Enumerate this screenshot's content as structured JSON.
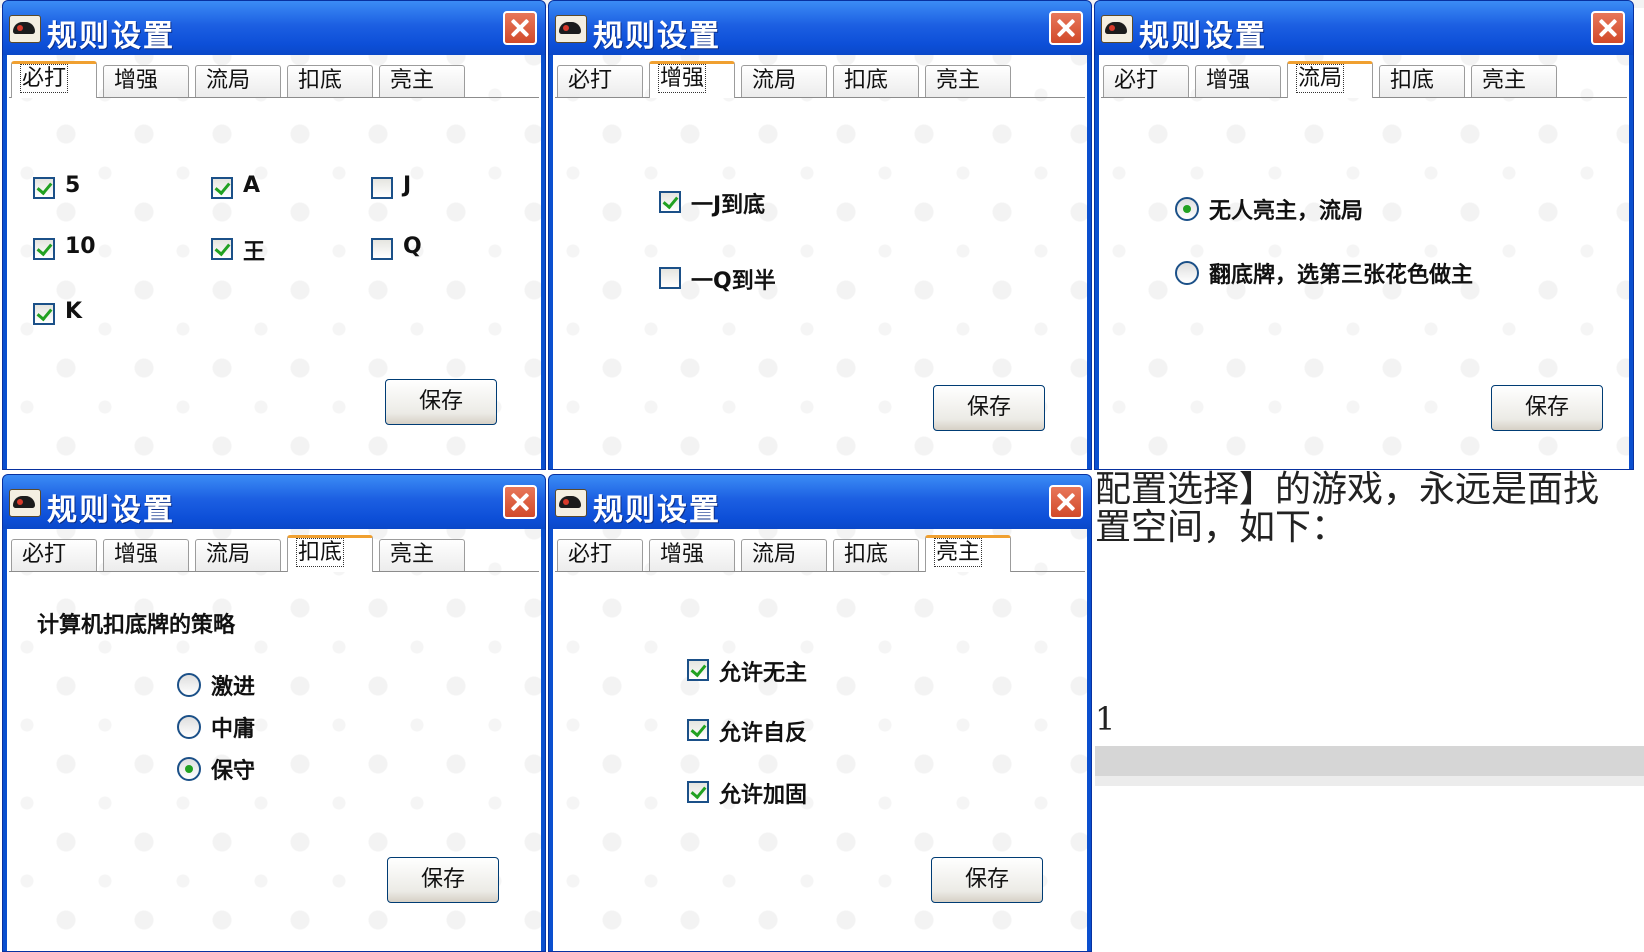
{
  "dialog_title": "规则设置",
  "tabs": [
    "必打",
    "增强",
    "流局",
    "扣底",
    "亮主"
  ],
  "save_label": "保存",
  "background": {
    "line1": "配置选择】的游戏，永远是面找",
    "line2": "置空间，如下：",
    "num": "1"
  },
  "dialog_bida": {
    "active_tab": "必打",
    "options": [
      {
        "label": "5",
        "checked": true
      },
      {
        "label": "A",
        "checked": true
      },
      {
        "label": "J",
        "checked": false
      },
      {
        "label": "10",
        "checked": true
      },
      {
        "label": "王",
        "checked": true
      },
      {
        "label": "Q",
        "checked": false
      },
      {
        "label": "K",
        "checked": true
      }
    ]
  },
  "dialog_zengqiang": {
    "active_tab": "增强",
    "options": [
      {
        "label": "一J到底",
        "checked": true
      },
      {
        "label": "一Q到半",
        "checked": false
      }
    ]
  },
  "dialog_liuju": {
    "active_tab": "流局",
    "options": [
      {
        "label": "无人亮主，流局",
        "selected": true
      },
      {
        "label": "翻底牌，选第三张花色做主",
        "selected": false
      }
    ]
  },
  "dialog_koudi": {
    "active_tab": "扣底",
    "heading": "计算机扣底牌的策略",
    "options": [
      {
        "label": "激进",
        "selected": false
      },
      {
        "label": "中庸",
        "selected": false
      },
      {
        "label": "保守",
        "selected": true
      }
    ]
  },
  "dialog_liangzhu": {
    "active_tab": "亮主",
    "options": [
      {
        "label": "允许无主",
        "checked": true
      },
      {
        "label": "允许自反",
        "checked": true
      },
      {
        "label": "允许加固",
        "checked": true
      }
    ]
  }
}
